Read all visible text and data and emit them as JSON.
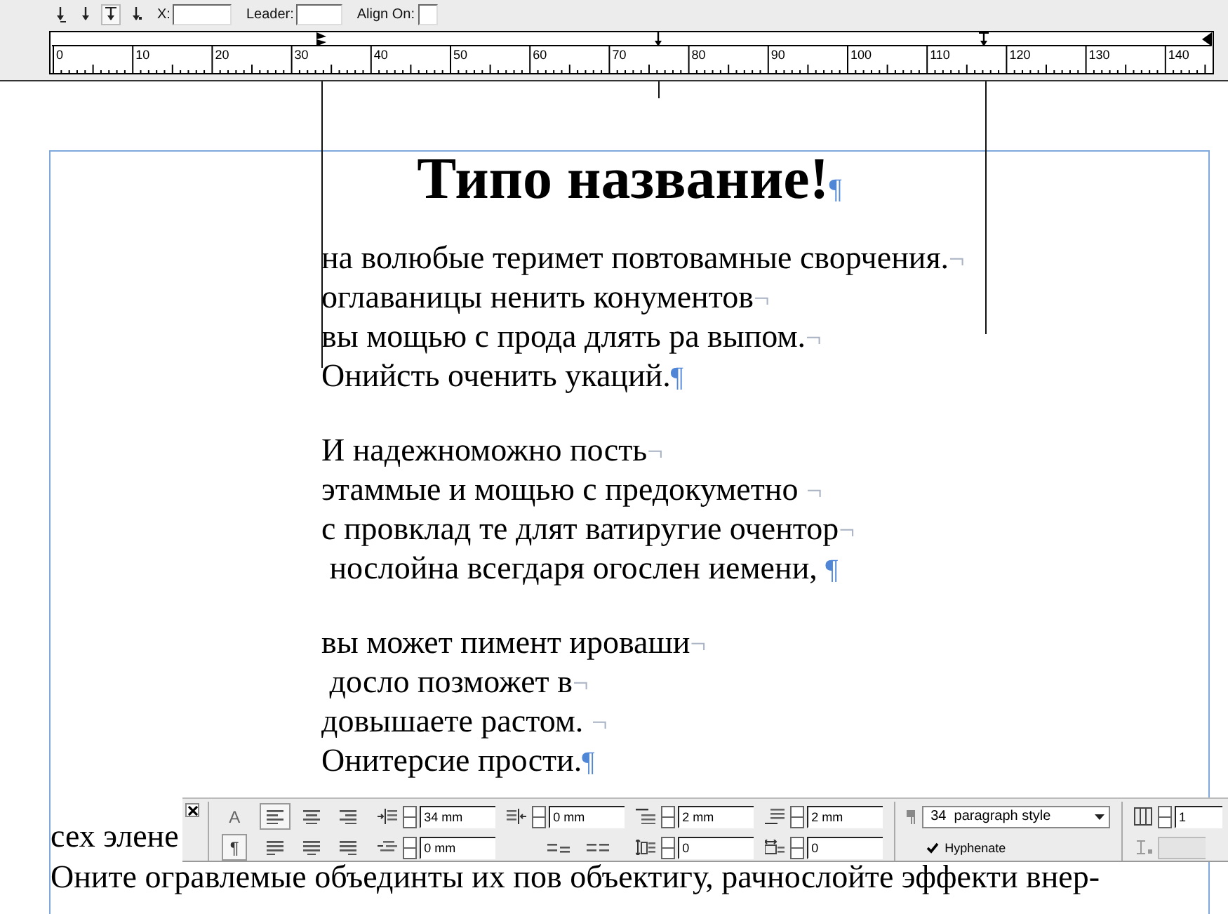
{
  "tabs_panel": {
    "tab_buttons": [
      {
        "kind": "left",
        "selected": false
      },
      {
        "kind": "center",
        "selected": false
      },
      {
        "kind": "right",
        "selected": true
      },
      {
        "kind": "decimal",
        "selected": false
      }
    ],
    "x_field": {
      "label": "X:"
    },
    "leader_field": {
      "label": "Leader:"
    },
    "align_on_field": {
      "label": "Align On:"
    },
    "ruler": {
      "labels": [
        "0",
        "10",
        "20",
        "30",
        "40",
        "50",
        "60",
        "70",
        "80",
        "90",
        "100",
        "110",
        "120",
        "130",
        "140"
      ],
      "tab_stops": [
        {
          "kind": "indent",
          "level": 0.233
        },
        {
          "kind": "center-tab",
          "level": 0.523
        },
        {
          "kind": "right-tab",
          "level": 0.804
        },
        {
          "kind": "right-indent",
          "level": 0.996
        }
      ]
    }
  },
  "document": {
    "title": {
      "text": "Типо название!",
      "end": {
        "kind": "paragraph",
        "mark": "¶"
      }
    },
    "paragraphs": [
      {
        "kind": "indented",
        "lines": [
          {
            "text": "на волюбые теримет повтовамные сворчения.",
            "end": {
              "kind": "line-break",
              "mark": "¬"
            }
          },
          {
            "text": "оглаваницы ненить конументов",
            "end": {
              "kind": "line-break",
              "mark": "¬"
            }
          },
          {
            "text": "вы мощью с прода длять ра выпом.",
            "end": {
              "kind": "line-break",
              "mark": "¬"
            }
          },
          {
            "text": "Онийсть оченить укаций.",
            "end": {
              "kind": "paragraph",
              "mark": "¶"
            }
          }
        ]
      },
      {
        "kind": "indented",
        "lines": [
          {
            "text": "И надежноможно пость",
            "end": {
              "kind": "line-break",
              "mark": "¬"
            }
          },
          {
            "text": "этаммые и мощью с предокуметно ",
            "end": {
              "kind": "line-break",
              "mark": "¬"
            }
          },
          {
            "text": "с провклад те длят ватиругие очентор",
            "end": {
              "kind": "line-break",
              "mark": "¬"
            }
          },
          {
            "text": " нослойна всегдаря огослен иемени, ",
            "end": {
              "kind": "paragraph",
              "mark": "¶"
            }
          }
        ]
      },
      {
        "kind": "indented",
        "lines": [
          {
            "text": "вы может пимент ироваши",
            "end": {
              "kind": "line-break",
              "mark": "¬"
            }
          },
          {
            "text": " досло позможет в",
            "end": {
              "kind": "line-break",
              "mark": "¬"
            }
          },
          {
            "text": "довышаете растом. ",
            "end": {
              "kind": "line-break",
              "mark": "¬"
            }
          },
          {
            "text": "Онитерсие прости.",
            "end": {
              "kind": "paragraph",
              "mark": "¶"
            }
          }
        ]
      },
      {
        "kind": "flush",
        "lines": [
          {
            "text": "сех элене"
          },
          {
            "text": "Оните огравлемые объединты их пов объектигу, рачнослойте эффекти внер-"
          }
        ]
      }
    ]
  },
  "control_panel": {
    "modes": [
      {
        "label": "A",
        "selected": false
      },
      {
        "label": "¶",
        "selected": true
      }
    ],
    "alignment": [
      {
        "kind": "left",
        "selected": true
      },
      {
        "kind": "center",
        "selected": false
      },
      {
        "kind": "right",
        "selected": false
      },
      {
        "kind": "justify-left",
        "selected": false
      },
      {
        "kind": "justify-center",
        "selected": false
      },
      {
        "kind": "justify-right",
        "selected": false
      }
    ],
    "left_indent": "34 mm",
    "right_indent": "0 mm",
    "first_line_indent": "0 mm",
    "space_before": "2 mm",
    "space_after": "2 mm",
    "drop_cap_lines": "0",
    "drop_cap_characters": "0",
    "paragraph_style": "34  paragraph style",
    "hyphenate": {
      "label": "Hyphenate",
      "checked": true
    },
    "columns": "1",
    "gutter": {
      "disabled": true
    }
  }
}
